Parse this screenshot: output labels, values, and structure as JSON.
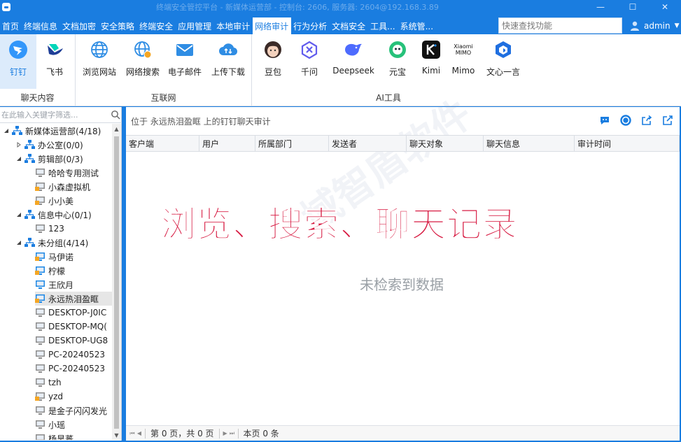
{
  "window": {
    "title": "终端安全管控平台 - 新媒体运营部 - 控制台: 2606, 服务器: 2604@192.168.3.89",
    "minimize": "—",
    "maximize": "☐",
    "close": "✕"
  },
  "menu": {
    "items": [
      "首页",
      "终端信息",
      "文档加密",
      "安全策略",
      "终端安全",
      "应用管理",
      "本地审计",
      "网络审计",
      "行为分析",
      "文档安全",
      "工具...",
      "系统管..."
    ],
    "active_index": 7,
    "search_placeholder": "快速查找功能",
    "user": "admin"
  },
  "ribbon": {
    "groups": [
      {
        "label": "聊天内容",
        "buttons": [
          {
            "label": "钉钉",
            "icon": "dingtalk-icon"
          },
          {
            "label": "飞书",
            "icon": "feishu-icon"
          }
        ]
      },
      {
        "label": "互联网",
        "buttons": [
          {
            "label": "浏览网站",
            "icon": "globe-icon"
          },
          {
            "label": "网络搜索",
            "icon": "globe-search-icon"
          },
          {
            "label": "电子邮件",
            "icon": "mail-icon"
          },
          {
            "label": "上传下载",
            "icon": "cloud-transfer-icon"
          }
        ]
      },
      {
        "label": "AI工具",
        "buttons": [
          {
            "label": "豆包",
            "icon": "doubao-icon"
          },
          {
            "label": "千问",
            "icon": "qianwen-icon"
          },
          {
            "label": "Deepseek",
            "icon": "deepseek-icon"
          },
          {
            "label": "元宝",
            "icon": "yuanbao-icon"
          },
          {
            "label": "Kimi",
            "icon": "kimi-icon"
          },
          {
            "label": "Mimo",
            "icon": "mimo-icon",
            "icon_text": "Xiaomi\nMIMO"
          },
          {
            "label": "文心一言",
            "icon": "wenxin-icon"
          }
        ]
      }
    ],
    "active_button": "钉钉"
  },
  "tree": {
    "filter_placeholder": "在此输入关键字筛选...",
    "nodes": [
      {
        "label": "新媒体运营部(4/18)",
        "type": "group",
        "level": 0,
        "expanded": true
      },
      {
        "label": "办公室(0/0)",
        "type": "group",
        "level": 1,
        "expanded": false
      },
      {
        "label": "剪辑部(0/3)",
        "type": "group",
        "level": 1,
        "expanded": true
      },
      {
        "label": "哈哈专用测试",
        "type": "pc-offline",
        "level": 2
      },
      {
        "label": "小森虚拟机",
        "type": "pc-offline-lock",
        "level": 2
      },
      {
        "label": "小小美",
        "type": "pc-offline-lock",
        "level": 2
      },
      {
        "label": "信息中心(0/1)",
        "type": "group",
        "level": 1,
        "expanded": true
      },
      {
        "label": "123",
        "type": "pc-offline",
        "level": 2
      },
      {
        "label": "未分组(4/14)",
        "type": "group",
        "level": 1,
        "expanded": true
      },
      {
        "label": "马伊诺",
        "type": "pc-online-lock",
        "level": 2
      },
      {
        "label": "柠檬",
        "type": "pc-online-lock",
        "level": 2
      },
      {
        "label": "王欣月",
        "type": "pc-online",
        "level": 2
      },
      {
        "label": "永远热泪盈眶",
        "type": "pc-online-lock",
        "level": 2,
        "selected": true
      },
      {
        "label": "DESKTOP-J0IC",
        "type": "pc-offline",
        "level": 2
      },
      {
        "label": "DESKTOP-MQ(",
        "type": "pc-offline",
        "level": 2
      },
      {
        "label": "DESKTOP-UG8",
        "type": "pc-offline",
        "level": 2
      },
      {
        "label": "PC-20240523",
        "type": "pc-offline",
        "level": 2
      },
      {
        "label": "PC-20240523",
        "type": "pc-offline",
        "level": 2
      },
      {
        "label": "tzh",
        "type": "pc-offline",
        "level": 2
      },
      {
        "label": "yzd",
        "type": "pc-offline-lock",
        "level": 2
      },
      {
        "label": "是金子闪闪发光",
        "type": "pc-offline",
        "level": 2
      },
      {
        "label": "小瑶",
        "type": "pc-offline",
        "level": 2
      },
      {
        "label": "杨昊蕃",
        "type": "pc-offline",
        "level": 2
      }
    ]
  },
  "main": {
    "location": "位于 永远热泪盈眶 上的钉钉聊天审计",
    "columns": [
      "客户端",
      "用户",
      "所属部门",
      "发送者",
      "聊天对象",
      "聊天信息",
      "审计时间"
    ],
    "overlay_caption": "浏览、搜索、聊天记录",
    "empty_text": "未检索到数据",
    "watermark": "域智盾软件",
    "pager": {
      "page_text": "第 0 页，共 0 页",
      "count_text": "本页 0 条"
    }
  },
  "colors": {
    "accent": "#1a7de0",
    "caption": "#d6163e",
    "online_pc": "#1e88e5",
    "offline_pc": "#8c8c8c"
  }
}
